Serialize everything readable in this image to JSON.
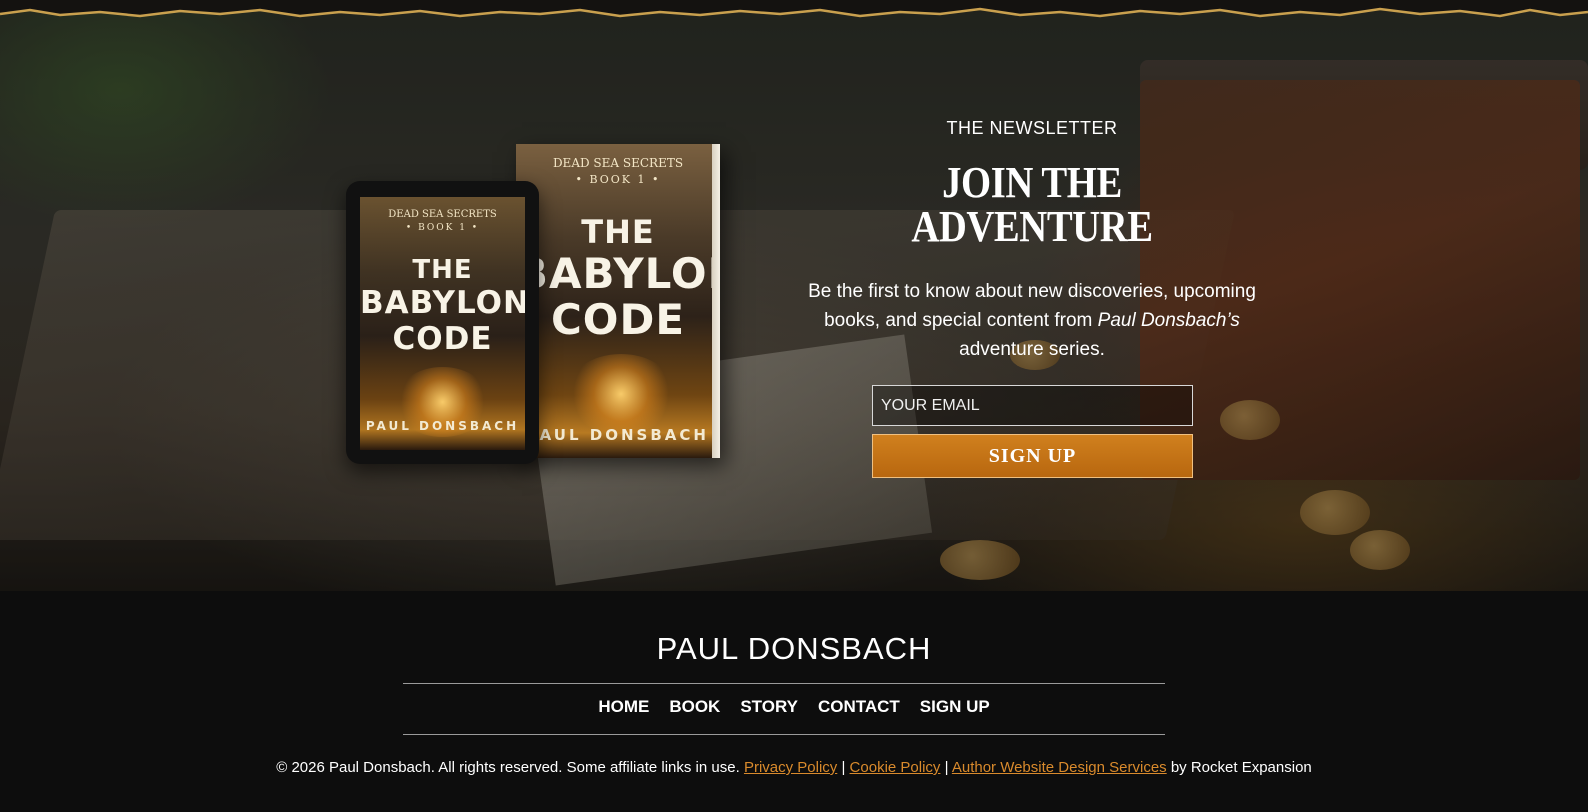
{
  "hero": {
    "book": {
      "series": "DEAD SEA SECRETS",
      "volume": "• BOOK 1 •",
      "title_line1": "THE",
      "title_line2": "BABYLON",
      "title_line3": "CODE",
      "author": "PAUL DONSBACH"
    },
    "newsletter": {
      "eyebrow": "THE NEWSLETTER",
      "heading": "JOIN THE ADVENTURE",
      "body_before": "Be the first to know about new discoveries, upcoming books, and special content from ",
      "body_author": "Paul Donsbach’s",
      "body_after": " adventure series.",
      "email_placeholder": "YOUR EMAIL",
      "button_label": "SIGN UP"
    }
  },
  "footer": {
    "name": "PAUL DONSBACH",
    "nav": [
      "HOME",
      "BOOK",
      "STORY",
      "CONTACT",
      "SIGN UP"
    ],
    "legal_text": "© 2026 Paul Donsbach. All rights reserved. Some affiliate links in use.",
    "privacy_label": "Privacy Policy",
    "cookie_label": "Cookie Policy",
    "design_label": "Author Website Design Services",
    "separator": "|",
    "credit": "by Rocket Expansion"
  },
  "colors": {
    "accent": "#d0801e",
    "link": "#d98a2c",
    "footer_bg": "#0d0d0d"
  }
}
